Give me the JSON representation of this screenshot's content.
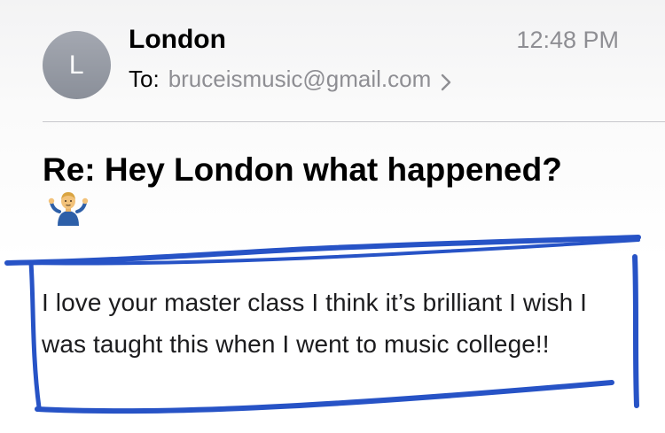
{
  "header": {
    "avatar_initial": "L",
    "sender": "London",
    "time": "12:48 PM",
    "to_label": "To:",
    "to_address": "bruceismusic@gmail.com",
    "chevron_icon": "chevron-right-icon"
  },
  "message": {
    "subject": "Re:  Hey London what happened?",
    "subject_emoji": "man-shrugging-emoji",
    "body": "I love your master class I think it’s brilliant I wish I was taught this when I went to music college!!"
  },
  "annotation": {
    "color": "#2753c6"
  }
}
